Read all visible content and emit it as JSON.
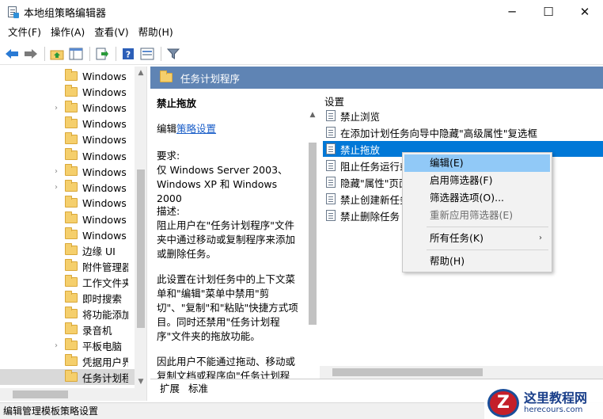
{
  "window": {
    "title": "本地组策略编辑器",
    "minimize": "─",
    "maximize": "☐",
    "close": "✕"
  },
  "menu": [
    "文件(F)",
    "操作(A)",
    "查看(V)",
    "帮助(H)"
  ],
  "tree": {
    "items": [
      {
        "label": "Windows H",
        "arrow": ""
      },
      {
        "label": "Windows Ir",
        "arrow": ""
      },
      {
        "label": "Windows M",
        "arrow": "›"
      },
      {
        "label": "Windows M",
        "arrow": ""
      },
      {
        "label": "Windows P",
        "arrow": ""
      },
      {
        "label": "Windows 错",
        "arrow": ""
      },
      {
        "label": "Windows 登",
        "arrow": "›"
      },
      {
        "label": "Windows 更",
        "arrow": "›"
      },
      {
        "label": "Windows E",
        "arrow": ""
      },
      {
        "label": "Windows 颜",
        "arrow": ""
      },
      {
        "label": "Windows 移",
        "arrow": ""
      },
      {
        "label": "边缘 UI",
        "arrow": ""
      },
      {
        "label": "附件管理器",
        "arrow": ""
      },
      {
        "label": "工作文件夹",
        "arrow": ""
      },
      {
        "label": "即时搜索",
        "arrow": ""
      },
      {
        "label": "将功能添加",
        "arrow": ""
      },
      {
        "label": "录音机",
        "arrow": ""
      },
      {
        "label": "平板电脑",
        "arrow": "›"
      },
      {
        "label": "凭据用户界面",
        "arrow": ""
      },
      {
        "label": "任务计划程序",
        "arrow": ""
      }
    ],
    "selected_index": 19
  },
  "right": {
    "header": "任务计划程序",
    "desc_title": "禁止拖放",
    "edit_prefix": "编辑",
    "edit_link": "策略设置",
    "req_label": "要求:",
    "req_text": "仅 Windows Server 2003、Windows XP 和 Windows 2000",
    "desc_label": "描述:",
    "desc_text1": "阻止用户在\"任务计划程序\"文件夹中通过移动或复制程序来添加或删除任务。",
    "desc_text2": "此设置在计划任务中的上下文菜单和\"编辑\"菜单中禁用\"剪切\"、\"复制\"和\"粘贴\"快捷方式项目。同时还禁用\"任务计划程序\"文件夹的拖放功能。",
    "desc_text3": "因此用户不能通过拖动、移动或复制文档或程序向\"任务计划程序\"文件夹添加新的计划任务。",
    "list_header": "设置",
    "list": [
      "禁止浏览",
      "在添加计划任务向导中隐藏\"高级属性\"复选框",
      "禁止拖放",
      "阻止任务运行或",
      "隐藏\"属性\"页面",
      "禁止创建新任务",
      "禁止删除任务"
    ],
    "selected_index": 2,
    "tabs": [
      "扩展",
      "标准"
    ]
  },
  "context_menu": {
    "items": [
      {
        "label": "编辑(E)",
        "state": "hover"
      },
      {
        "label": "启用筛选器(F)",
        "state": "normal"
      },
      {
        "label": "筛选器选项(O)...",
        "state": "normal"
      },
      {
        "label": "重新应用筛选器(E)",
        "state": "disabled"
      },
      {
        "label": "所有任务(K)",
        "state": "submenu",
        "arrow": "›"
      },
      {
        "label": "帮助(H)",
        "state": "normal"
      }
    ]
  },
  "status": "编辑管理模板策略设置",
  "watermark": {
    "logo": "Z",
    "cn": "这里教程网",
    "en": "herecours.com"
  },
  "colors": {
    "header_bg": "#5f84b4",
    "selection": "#0078d7",
    "menu_hover": "#91c9f7"
  }
}
